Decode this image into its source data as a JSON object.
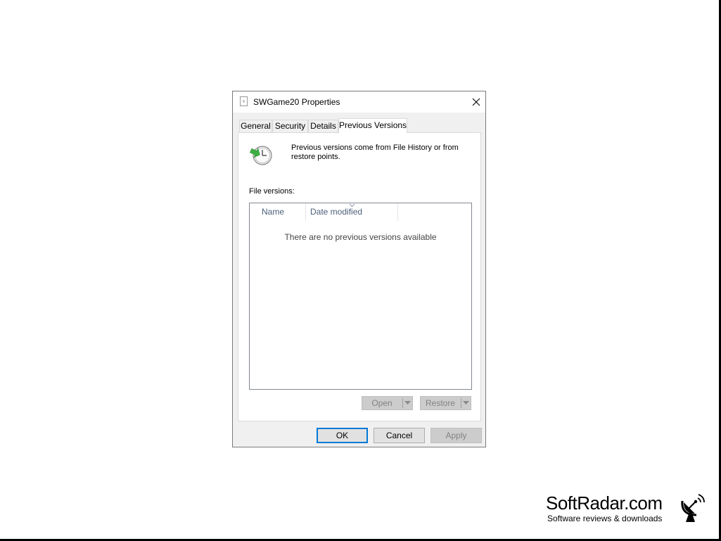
{
  "window": {
    "title": "SWGame20 Properties",
    "close_label": "×"
  },
  "tabs": [
    {
      "label": "General",
      "active": false
    },
    {
      "label": "Security",
      "active": false
    },
    {
      "label": "Details",
      "active": false
    },
    {
      "label": "Previous Versions",
      "active": true
    }
  ],
  "panel": {
    "info_text": "Previous versions come from File History or from restore points.",
    "file_versions_label": "File versions:",
    "columns": [
      "Name",
      "Date modified"
    ],
    "empty_message": "There are no previous versions available",
    "open_label": "Open",
    "restore_label": "Restore"
  },
  "footer": {
    "ok_label": "OK",
    "cancel_label": "Cancel",
    "apply_label": "Apply"
  },
  "watermark": {
    "name": "SoftRadar.com",
    "tagline": "Software reviews & downloads"
  },
  "colors": {
    "focus_border": "#0078d7",
    "disabled_text": "#838383",
    "header_text": "#4c607a"
  }
}
